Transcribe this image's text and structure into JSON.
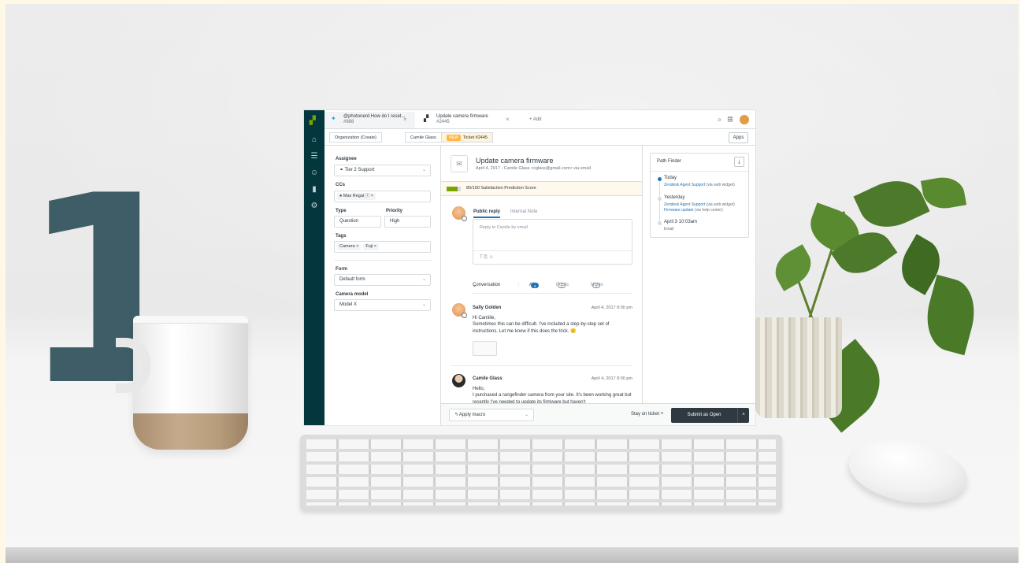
{
  "hero_number": "1",
  "colors": {
    "accent": "#1f73b7",
    "nav_bg": "#03363d",
    "brand_green": "#78a300",
    "submit_bg": "#2f3941",
    "new_badge": "#ffb648"
  },
  "nav": {
    "icons": [
      "zendesk-logo",
      "home-icon",
      "views-icon",
      "customers-icon",
      "reporting-icon",
      "admin-gear-icon"
    ]
  },
  "tabs": [
    {
      "title": "@photonerd How do I reset...",
      "sub": "#888",
      "icon": "twitter-icon"
    },
    {
      "title": "Update camera firmware",
      "sub": "#2445",
      "icon": "zendesk-icon"
    }
  ],
  "add_tab": "+  Add",
  "breadcrumbs": [
    "Organization (Create)",
    "Camile Glass",
    "Ticket #2445"
  ],
  "new_badge": "NEW",
  "apps_button": "Apps",
  "left": {
    "assignee_label": "Assignee",
    "assignee_value": "Tier 2 Support",
    "ccs_label": "CCs",
    "cc_value": "Max Regal",
    "type_label": "Type",
    "type_value": "Question",
    "priority_label": "Priority",
    "priority_value": "High",
    "tags_label": "Tags",
    "tags": [
      "Camera",
      "Fuji"
    ],
    "form_label": "Form",
    "form_value": "Default form",
    "camera_label": "Camera model",
    "camera_value": "Model X"
  },
  "ticket": {
    "title": "Update camera firmware",
    "meta": "April 4, 2017 - Camile Glass <cglass@gmail.com> via email",
    "satisfaction_fraction": 0.8,
    "satisfaction_text": "80/100 Satisfaction Prediction Score",
    "reply_tab": "Public reply",
    "note_tab": "Internal Note",
    "reply_placeholder": "Reply to Camile by email",
    "tools": "T  ⎘  ☺",
    "filters": {
      "conversation": "Conversation",
      "all": "All",
      "all_count": "4",
      "public": "Public",
      "public_count": "2",
      "notes": "Notes",
      "notes_count": "2"
    },
    "messages": [
      {
        "name": "Sally Golden",
        "date": "April 4, 2017 8:00 pm",
        "greeting": "Hi Camille,",
        "body": "Sometimes this can be difficult. I've included a step-by-step set of instructions. Let me know if this does the trick. 🙂"
      },
      {
        "name": "Camile Glass",
        "date": "April 4, 2017 8:00 pm",
        "greeting": "Hello,",
        "body": "I purchased a rangefinder camera from your site. It's been working great but recently I've needed to update its firmware but haven't"
      }
    ]
  },
  "path_finder": {
    "title": "Path Finder",
    "today": "Today",
    "today_link": "Zendesk Agent Support",
    "today_via": "(via web widget)",
    "yesterday": "Yesterday",
    "yesterday_link1": "Zendesk Agent Support",
    "yesterday_via1": "(via web widget)",
    "yesterday_link2": "Firmware update",
    "yesterday_via2": "(via help center)",
    "april": "April 3 10:03am",
    "april_sub": "Email"
  },
  "bottom": {
    "apply_macro": "Apply macro",
    "stay": "Stay on ticket",
    "submit": "Submit as Open"
  }
}
